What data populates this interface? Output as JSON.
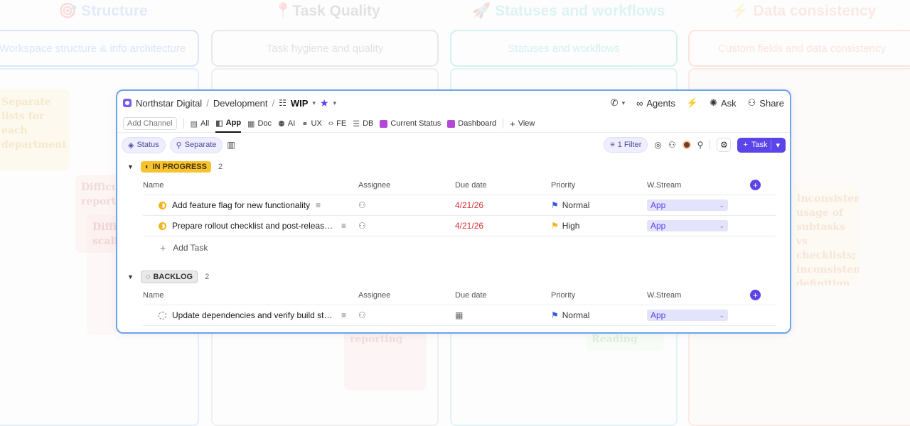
{
  "background": {
    "columns": [
      {
        "title": "🎯 Structure",
        "box": "Workspace structure & info architecture",
        "color": "#4f8ff5"
      },
      {
        "title": "📍Task Quality",
        "box": "Task hygiene and quality",
        "color": "#888888"
      },
      {
        "title": "🚀 Statuses and workflows",
        "box": "Statuses and workflows",
        "color": "#2ec6b9"
      },
      {
        "title": "⚡ Data consistency",
        "box": "Custom fields and data consistency",
        "color": "#f5815b"
      }
    ],
    "notes": [
      "Separate lists for each department",
      "Difficult reporting",
      "Difficult scaling",
      "Inconsistent usage of subtasks vs checklists; inconsistent definition of \"done.\"",
      "reporting",
      "Reading"
    ]
  },
  "breadcrumb": {
    "workspace": "Northstar Digital",
    "space": "Development",
    "list": "WIP"
  },
  "top_actions": {
    "agents": "Agents",
    "ask": "Ask",
    "share": "Share"
  },
  "views": {
    "add_channel": "Add Channel",
    "tabs": [
      "All",
      "App",
      "Doc",
      "AI",
      "UX",
      "FE",
      "DB",
      "Current Status",
      "Dashboard"
    ],
    "active": "App",
    "add_view": "View"
  },
  "toolbar": {
    "status_chip": "Status",
    "separate_chip": "Separate",
    "filter": "1 Filter",
    "task_button": "Task"
  },
  "columns": {
    "name": "Name",
    "assignee": "Assignee",
    "due_date": "Due date",
    "priority": "Priority",
    "wstream": "W.Stream"
  },
  "groups": [
    {
      "status": "IN PROGRESS",
      "count": "2",
      "tasks": [
        {
          "name": "Add feature flag for new functionality",
          "due": "4/21/26",
          "priority": "Normal",
          "wstream": "App"
        },
        {
          "name": "Prepare rollout checklist and post-release monitoring",
          "due": "4/21/26",
          "priority": "High",
          "wstream": "App"
        }
      ],
      "add_task": "Add Task"
    },
    {
      "status": "BACKLOG",
      "count": "2",
      "tasks": [
        {
          "name": "Update dependencies and verify build stability",
          "due": "",
          "priority": "Normal",
          "wstream": "App"
        }
      ]
    }
  ],
  "colors": {
    "accent": "#5b44e8",
    "in_progress": "#f7c331",
    "due_overdue": "#d63131",
    "window_border": "#6aa3f0"
  }
}
